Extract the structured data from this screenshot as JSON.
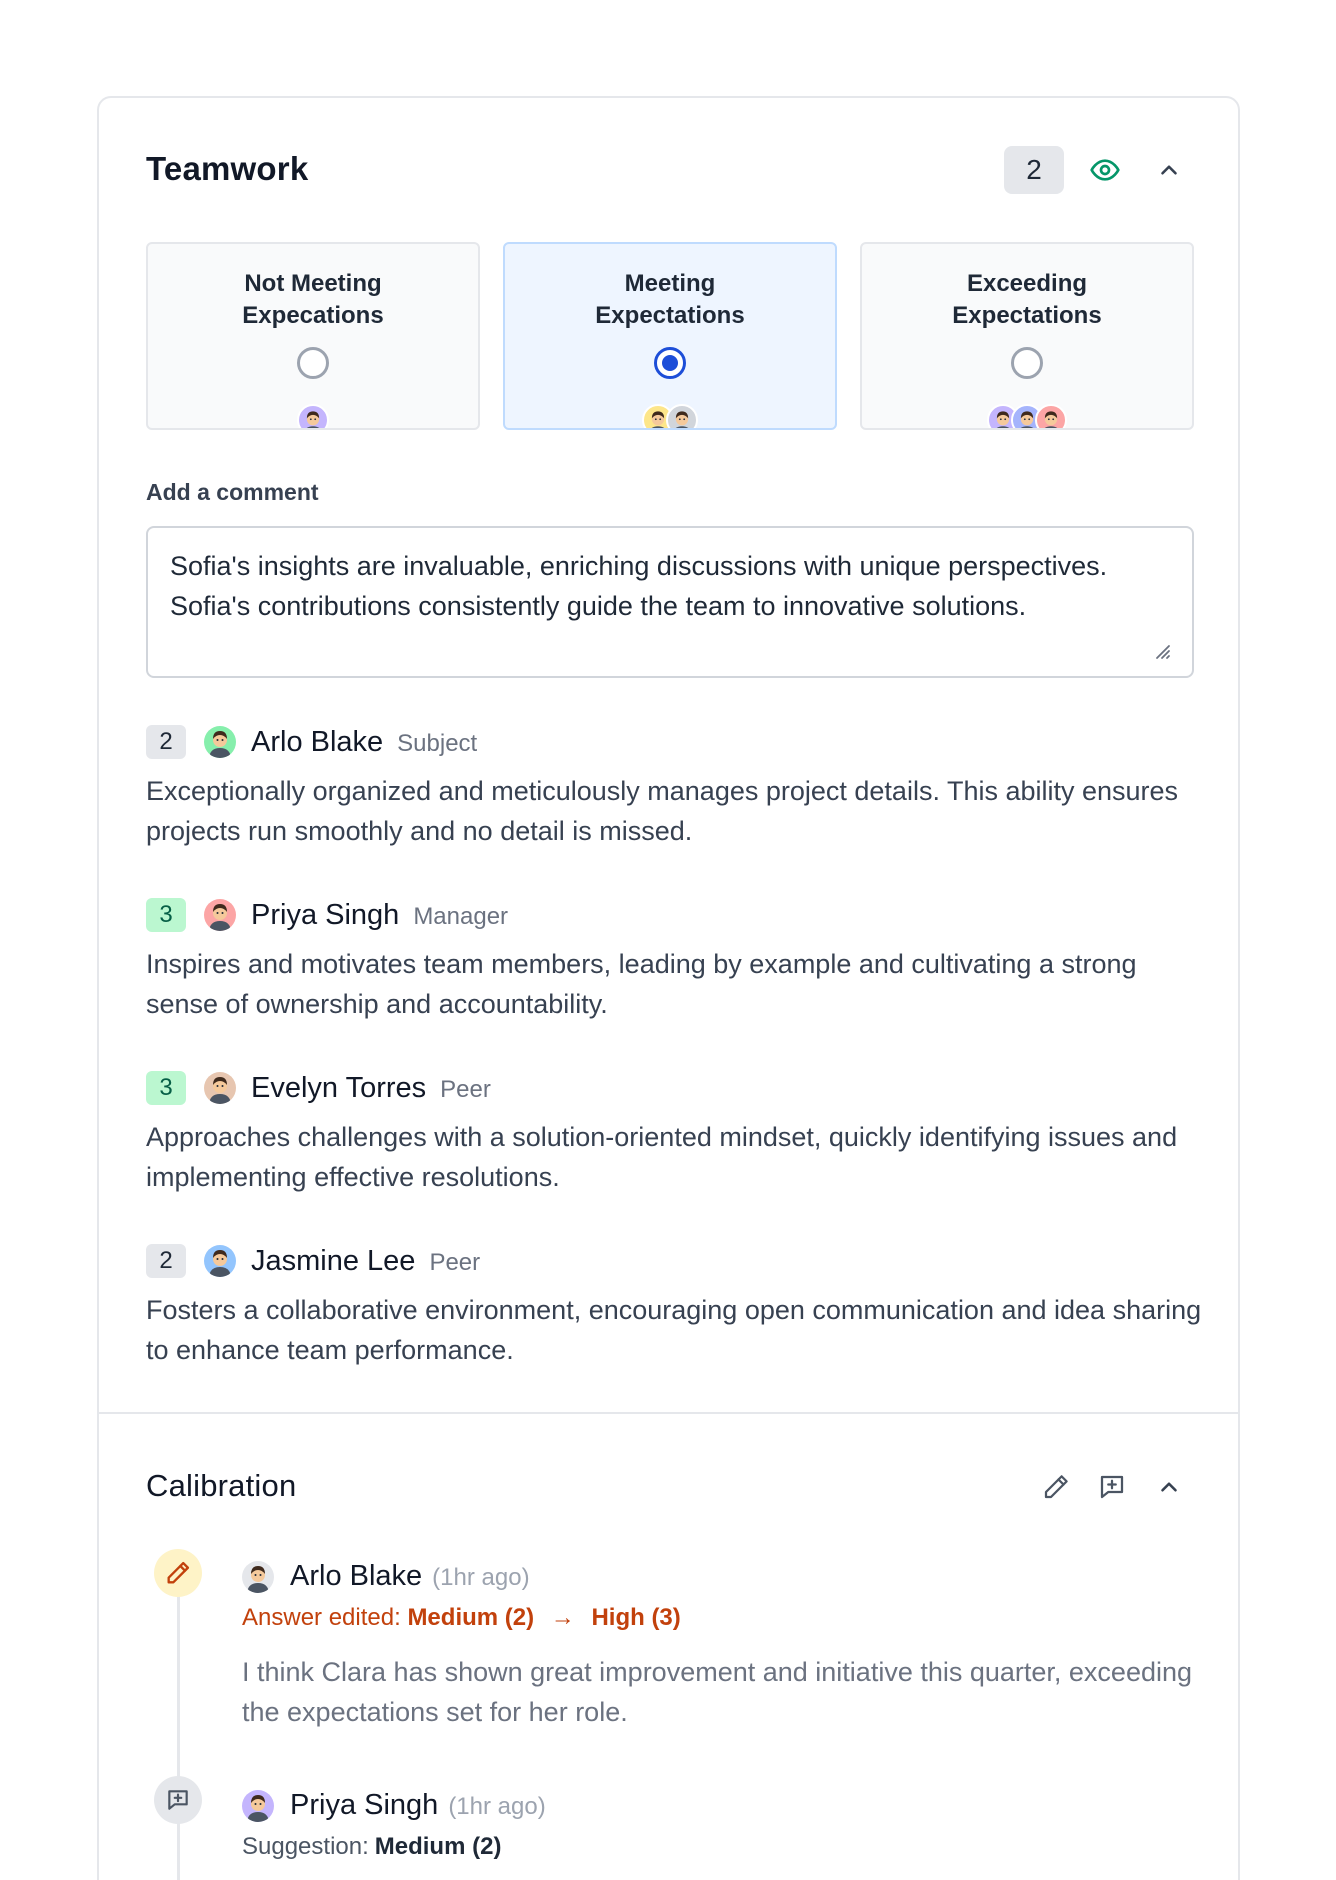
{
  "teamwork": {
    "title": "Teamwork",
    "score": "2",
    "options": [
      {
        "label": "Not Meeting\nExpecations",
        "selected": false
      },
      {
        "label": "Meeting\nExpectations",
        "selected": true
      },
      {
        "label": "Exceeding\nExpectations",
        "selected": false
      }
    ],
    "comment_label": "Add a comment",
    "comment_value": "Sofia's insights are invaluable, enriching discussions with unique perspectives. Sofia's contributions consistently guide the team to innovative solutions."
  },
  "responses": [
    {
      "score": "2",
      "score_color": "gray",
      "name": "Arlo Blake",
      "role": "Subject",
      "text": "Exceptionally organized and meticulously manages project details. This ability ensures projects run smoothly and no detail is missed."
    },
    {
      "score": "3",
      "score_color": "green",
      "name": "Priya Singh",
      "role": "Manager",
      "text": "Inspires and motivates team members, leading by example and cultivating a strong sense of ownership and accountability."
    },
    {
      "score": "3",
      "score_color": "green",
      "name": "Evelyn Torres",
      "role": "Peer",
      "text": "Approaches challenges with a solution-oriented mindset, quickly identifying issues and implementing effective resolutions."
    },
    {
      "score": "2",
      "score_color": "gray",
      "name": "Jasmine Lee",
      "role": "Peer",
      "text": "Fosters a collaborative environment, encouraging open communication and idea sharing to enhance team performance."
    }
  ],
  "calibration": {
    "title": "Calibration",
    "entries": [
      {
        "name": "Arlo Blake",
        "time": "(1hr ago)",
        "change_label": "Answer edited:",
        "from": "Medium (2)",
        "arrow": "→",
        "to": "High (3)",
        "text": "I think Clara has shown great improvement and initiative this quarter, exceeding the expectations set for her role."
      },
      {
        "name": "Priya Singh",
        "time": "(1hr ago)",
        "suggestion_label": "Suggestion:",
        "suggestion_value": "Medium (2)"
      }
    ]
  },
  "colors": {
    "accent_blue": "#1d4ed8",
    "eye_green": "#059669",
    "edit_orange": "#c2410c",
    "score_green_bg": "#bbf7d0"
  },
  "icons": [
    "eye-icon",
    "chevron-up-icon",
    "pencil-icon",
    "message-plus-icon",
    "resize-grip-icon"
  ]
}
